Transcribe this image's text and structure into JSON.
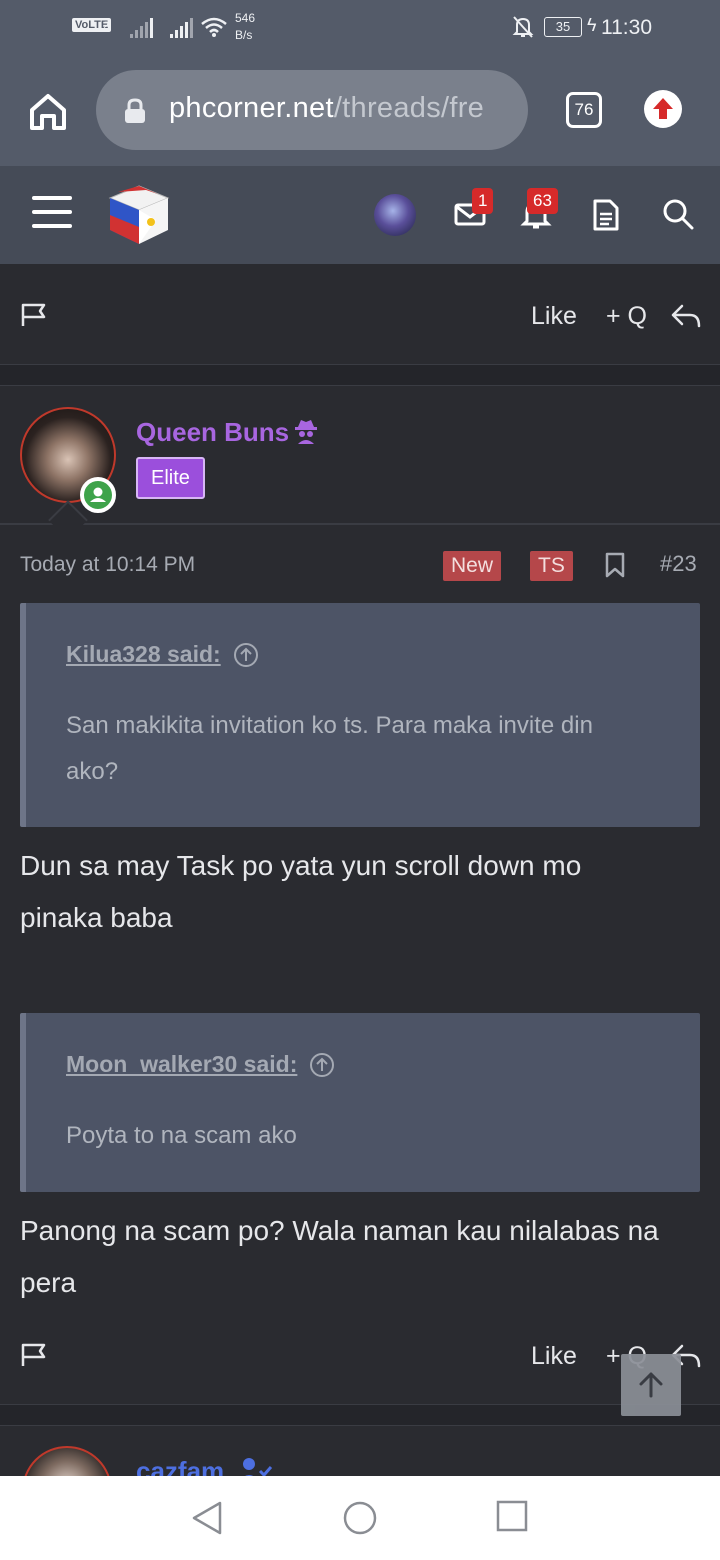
{
  "status_bar": {
    "volte": "VoLTE",
    "volte_sub": "2",
    "net_speed_value": "546",
    "net_speed_unit": "B/s",
    "battery": "35",
    "time": "11:30"
  },
  "browser": {
    "url_host": "phcorner.net",
    "url_path": "/threads/fre",
    "tab_count": "76"
  },
  "site_header": {
    "messages_badge": "1",
    "alerts_badge": "63"
  },
  "action_labels": {
    "like": "Like",
    "quote": "+ Q"
  },
  "post": {
    "username": "Queen Buns",
    "user_title": "Elite",
    "time": "Today at 10:14 PM",
    "tags": [
      "New",
      "TS"
    ],
    "post_number": "#23",
    "quotes": [
      {
        "author_line": "Kilua328 said:",
        "text_line1": "San makikita invitation ko ts. Para maka invite din",
        "text_line2": "ako?"
      },
      {
        "author_line": "Moon_walker30 said:",
        "text_line1": "Poyta to na scam ako"
      }
    ],
    "replies": [
      {
        "line1": "Dun sa may Task po yata yun scroll down mo",
        "line2": "pinaka baba"
      },
      {
        "line1": "Panong na scam po? Wala naman kau nilalabas na",
        "line2": "pera"
      }
    ]
  },
  "next_post": {
    "username": "cazfam"
  },
  "colors": {
    "status_bg": "#545b69",
    "page_bg": "#2a2b30",
    "username": "#a866e0",
    "elite_badge": "#9b4fdc",
    "tag_bg": "#b5474a",
    "quote_bg": "#4d5466",
    "badge_red": "#d62a2a",
    "next_username": "#4d6fe0"
  },
  "icons": [
    "home-icon",
    "lock-icon",
    "tabs-icon",
    "upload-icon",
    "menu-icon",
    "site-logo",
    "mail-icon",
    "bell-icon",
    "document-icon",
    "search-icon",
    "flag-icon",
    "reply-icon",
    "bookmark-icon",
    "spy-icon",
    "arrow-up-icon",
    "back-icon",
    "home-circle-icon",
    "recents-icon"
  ]
}
